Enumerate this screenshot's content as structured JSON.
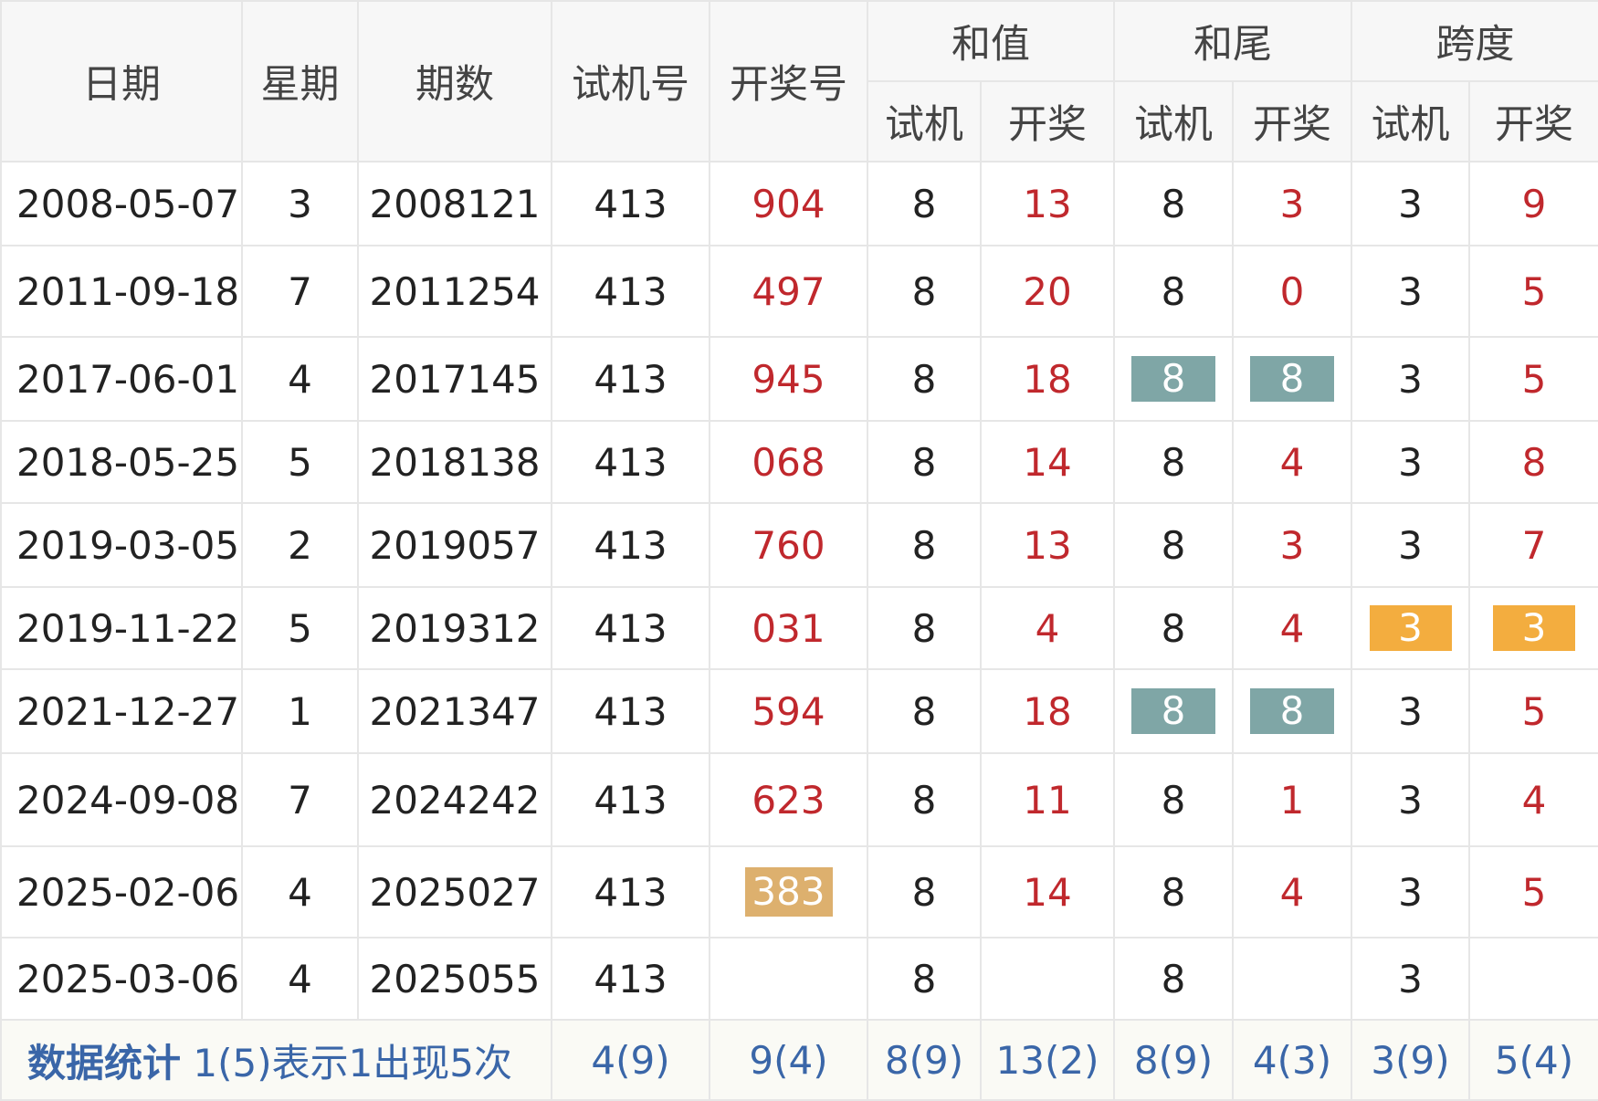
{
  "header": {
    "date": "日期",
    "weekday": "星期",
    "period": "期数",
    "test_no": "试机号",
    "draw_no": "开奖号",
    "sum": "和值",
    "sum_tail": "和尾",
    "span": "跨度",
    "sub_test": "试机",
    "sub_draw": "开奖"
  },
  "rows": [
    {
      "date": "2008-05-07",
      "weekday": "3",
      "period": "2008121",
      "test": "413",
      "draw": "904",
      "sum_test": "8",
      "sum_draw": "13",
      "tail_test": "8",
      "tail_draw": "3",
      "span_test": "3",
      "span_draw": "9"
    },
    {
      "date": "2011-09-18",
      "weekday": "7",
      "period": "2011254",
      "test": "413",
      "draw": "497",
      "sum_test": "8",
      "sum_draw": "20",
      "tail_test": "8",
      "tail_draw": "0",
      "span_test": "3",
      "span_draw": "5"
    },
    {
      "date": "2017-06-01",
      "weekday": "4",
      "period": "2017145",
      "test": "413",
      "draw": "945",
      "sum_test": "8",
      "sum_draw": "18",
      "tail_test": "8",
      "tail_draw": "8",
      "span_test": "3",
      "span_draw": "5"
    },
    {
      "date": "2018-05-25",
      "weekday": "5",
      "period": "2018138",
      "test": "413",
      "draw": "068",
      "sum_test": "8",
      "sum_draw": "14",
      "tail_test": "8",
      "tail_draw": "4",
      "span_test": "3",
      "span_draw": "8"
    },
    {
      "date": "2019-03-05",
      "weekday": "2",
      "period": "2019057",
      "test": "413",
      "draw": "760",
      "sum_test": "8",
      "sum_draw": "13",
      "tail_test": "8",
      "tail_draw": "3",
      "span_test": "3",
      "span_draw": "7"
    },
    {
      "date": "2019-11-22",
      "weekday": "5",
      "period": "2019312",
      "test": "413",
      "draw": "031",
      "sum_test": "8",
      "sum_draw": "4",
      "tail_test": "8",
      "tail_draw": "4",
      "span_test": "3",
      "span_draw": "3"
    },
    {
      "date": "2021-12-27",
      "weekday": "1",
      "period": "2021347",
      "test": "413",
      "draw": "594",
      "sum_test": "8",
      "sum_draw": "18",
      "tail_test": "8",
      "tail_draw": "8",
      "span_test": "3",
      "span_draw": "5"
    },
    {
      "date": "2024-09-08",
      "weekday": "7",
      "period": "2024242",
      "test": "413",
      "draw": "623",
      "sum_test": "8",
      "sum_draw": "11",
      "tail_test": "8",
      "tail_draw": "1",
      "span_test": "3",
      "span_draw": "4"
    },
    {
      "date": "2025-02-06",
      "weekday": "4",
      "period": "2025027",
      "test": "413",
      "draw": "383",
      "sum_test": "8",
      "sum_draw": "14",
      "tail_test": "8",
      "tail_draw": "4",
      "span_test": "3",
      "span_draw": "5"
    },
    {
      "date": "2025-03-06",
      "weekday": "4",
      "period": "2025055",
      "test": "413",
      "draw": "",
      "sum_test": "8",
      "sum_draw": "",
      "tail_test": "8",
      "tail_draw": "",
      "span_test": "3",
      "span_draw": ""
    }
  ],
  "footer": {
    "label_bold": "数据统计",
    "label_note": " 1(5)表示1出现5次",
    "test": "4(9)",
    "draw": "9(4)",
    "sum_test": "8(9)",
    "sum_draw": "13(2)",
    "tail_test": "8(9)",
    "tail_draw": "4(3)",
    "span_test": "3(9)",
    "span_draw": "5(4)"
  },
  "colors": {
    "draw_red": "#c0282d",
    "highlight_teal": "#7fa6a6",
    "highlight_orange": "#f3ad3f",
    "highlight_tan": "#ddb06e",
    "footer_blue": "#3a66a8"
  }
}
